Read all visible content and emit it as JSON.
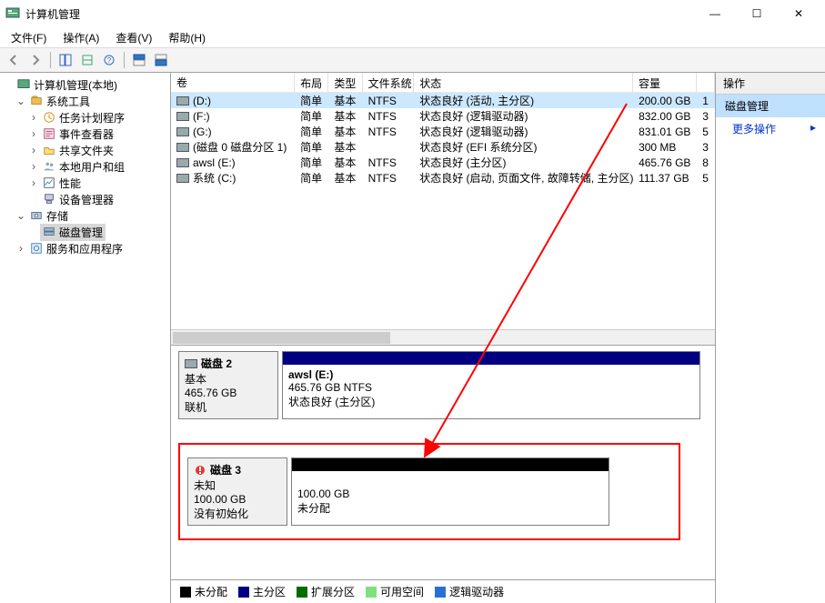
{
  "window": {
    "title": "计算机管理"
  },
  "menubar": {
    "file": "文件(F)",
    "action": "操作(A)",
    "view": "查看(V)",
    "help": "帮助(H)"
  },
  "tree": {
    "root": "计算机管理(本地)",
    "sys_tools": "系统工具",
    "task_sched": "任务计划程序",
    "event_viewer": "事件查看器",
    "shared": "共享文件夹",
    "users": "本地用户和组",
    "perf": "性能",
    "devmgr": "设备管理器",
    "storage": "存储",
    "diskmgmt": "磁盘管理",
    "svcapp": "服务和应用程序"
  },
  "vol_head": {
    "volume": "卷",
    "layout": "布局",
    "type": "类型",
    "fs": "文件系统",
    "status": "状态",
    "capacity": "容量",
    "last": ""
  },
  "volumes": [
    {
      "name": "(D:)",
      "layout": "简单",
      "type": "基本",
      "fs": "NTFS",
      "status": "状态良好 (活动, 主分区)",
      "capacity": "200.00 GB",
      "last": "1",
      "sel": true
    },
    {
      "name": "(F:)",
      "layout": "简单",
      "type": "基本",
      "fs": "NTFS",
      "status": "状态良好 (逻辑驱动器)",
      "capacity": "832.00 GB",
      "last": "3",
      "sel": false
    },
    {
      "name": "(G:)",
      "layout": "简单",
      "type": "基本",
      "fs": "NTFS",
      "status": "状态良好 (逻辑驱动器)",
      "capacity": "831.01 GB",
      "last": "5",
      "sel": false
    },
    {
      "name": "(磁盘 0 磁盘分区 1)",
      "layout": "简单",
      "type": "基本",
      "fs": "",
      "status": "状态良好 (EFI 系统分区)",
      "capacity": "300 MB",
      "last": "3",
      "sel": false
    },
    {
      "name": "awsl (E:)",
      "layout": "简单",
      "type": "基本",
      "fs": "NTFS",
      "status": "状态良好 (主分区)",
      "capacity": "465.76 GB",
      "last": "8",
      "sel": false
    },
    {
      "name": "系统 (C:)",
      "layout": "简单",
      "type": "基本",
      "fs": "NTFS",
      "status": "状态良好 (启动, 页面文件, 故障转储, 主分区)",
      "capacity": "111.37 GB",
      "last": "5",
      "sel": false
    }
  ],
  "disk2": {
    "title": "磁盘 2",
    "type": "基本",
    "size": "465.76 GB",
    "state": "联机",
    "part_title": "awsl  (E:)",
    "part_line2": "465.76 GB NTFS",
    "part_line3": "状态良好 (主分区)"
  },
  "disk3": {
    "title": "磁盘 3",
    "type": "未知",
    "size": "100.00 GB",
    "state": "没有初始化",
    "part_line2": "100.00 GB",
    "part_line3": "未分配"
  },
  "legend": {
    "unalloc": "未分配",
    "primary": "主分区",
    "extended": "扩展分区",
    "free": "可用空间",
    "logical": "逻辑驱动器"
  },
  "right": {
    "head": "操作",
    "category": "磁盘管理",
    "more": "更多操作"
  },
  "colors": {
    "unalloc": "#000000",
    "primary": "#000080",
    "extended": "#006c00",
    "free": "#7fe07f",
    "logical": "#2a6fd6"
  }
}
